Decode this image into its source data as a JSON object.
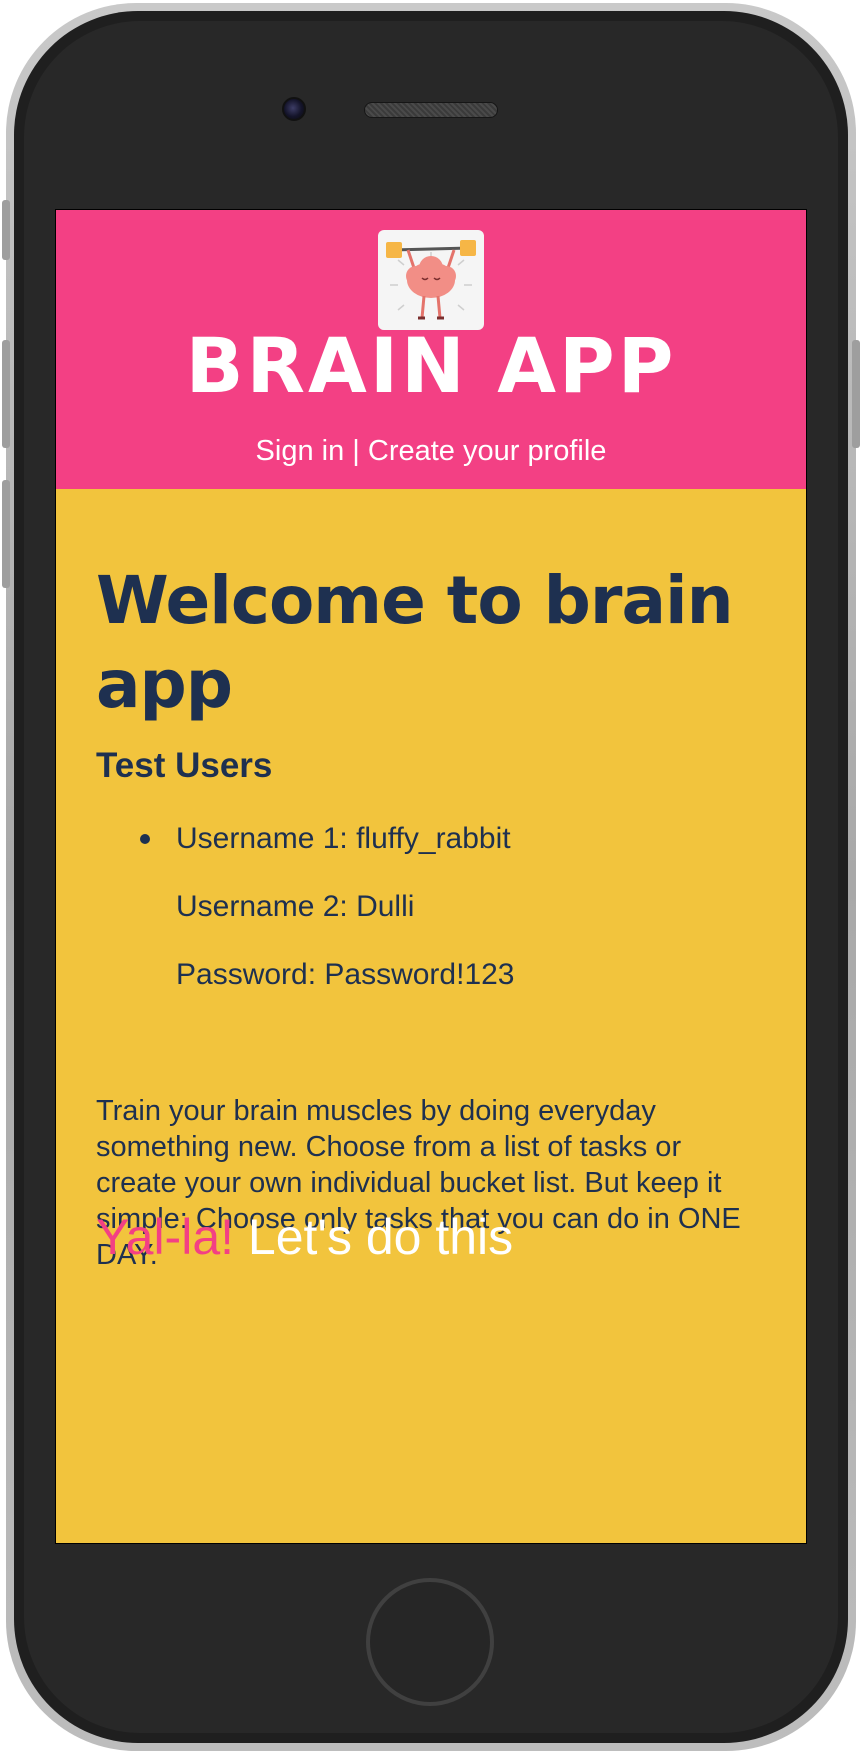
{
  "header": {
    "logo_icon": "brain-lifting-weights-icon",
    "app_title": "BRAIN APP",
    "sign_in": "Sign in",
    "separator": " | ",
    "create_profile": "Create your profile",
    "background_color": "#f34084"
  },
  "main": {
    "welcome_heading": "Welcome to brain app",
    "test_users_title": "Test Users",
    "test_users": [
      "Username 1: fluffy_rabbit",
      "Username 2: Dulli",
      "Password: Password!123"
    ],
    "description": "Train your brain muscles by doing everyday something new. Choose from a list of tasks or create your own individual bucket list. But keep it simple: Choose only tasks that you can do in ONE DAY.",
    "cta_accent": "Yal-la!",
    "cta_rest": " Let's do this",
    "background_color": "#f2c43d",
    "text_color": "#1e3050"
  }
}
